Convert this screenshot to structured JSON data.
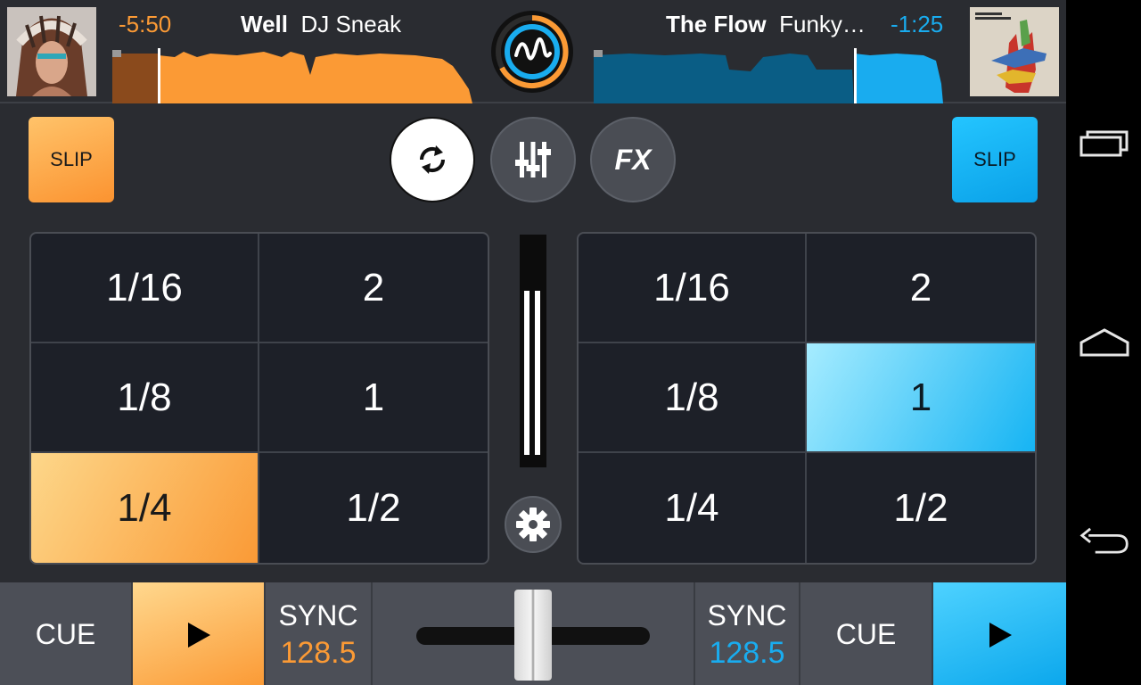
{
  "deck_a": {
    "time_remaining": "-5:50",
    "track_title": "Well",
    "artist": "DJ Sneak",
    "accent": "#fb9a35",
    "slip_label": "SLIP",
    "loop_pads": [
      "1/16",
      "2",
      "1/8",
      "1",
      "1/4",
      "1/2"
    ],
    "active_pad": "1/4",
    "cue_label": "CUE",
    "sync_label": "SYNC",
    "bpm": "128.5",
    "play_icon": "play-icon"
  },
  "deck_b": {
    "time_remaining": "-1:25",
    "track_title": "The Flow",
    "artist": "Funky…",
    "accent": "#19acef",
    "slip_label": "SLIP",
    "loop_pads": [
      "1/16",
      "2",
      "1/8",
      "1",
      "1/4",
      "1/2"
    ],
    "active_pad": "1",
    "cue_label": "CUE",
    "sync_label": "SYNC",
    "bpm": "128.5",
    "play_icon": "play-icon"
  },
  "toolbar": {
    "loop_icon": "loop-sync-icon",
    "mixer_icon": "mixer-sliders-icon",
    "fx_label": "FX",
    "settings_icon": "gear-icon"
  },
  "system_nav": {
    "recents_icon": "recent-apps-icon",
    "home_icon": "home-icon",
    "back_icon": "back-icon"
  }
}
